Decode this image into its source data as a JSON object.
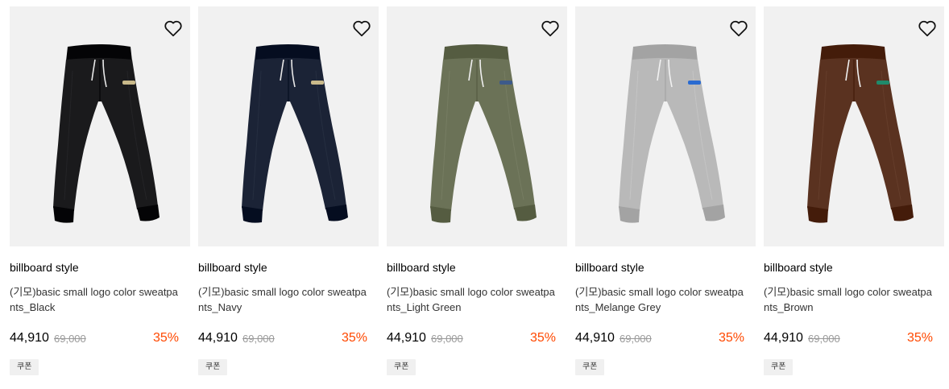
{
  "products": [
    {
      "brand": "billboard style",
      "name": "(기모)basic small logo color sweatpants_Black",
      "price": "44,910",
      "original_price": "69,000",
      "discount": "35%",
      "coupon": "쿠폰",
      "color": "#1a1a1c",
      "logo_color": "#c9b98a"
    },
    {
      "brand": "billboard style",
      "name": "(기모)basic small logo color sweatpants_Navy",
      "price": "44,910",
      "original_price": "69,000",
      "discount": "35%",
      "coupon": "쿠폰",
      "color": "#1b2336",
      "logo_color": "#c9b98a"
    },
    {
      "brand": "billboard style",
      "name": "(기모)basic small logo color sweatpants_Light Green",
      "price": "44,910",
      "original_price": "69,000",
      "discount": "35%",
      "coupon": "쿠폰",
      "color": "#6b7257",
      "logo_color": "#3d5a8a"
    },
    {
      "brand": "billboard style",
      "name": "(기모)basic small logo color sweatpants_Melange Grey",
      "price": "44,910",
      "original_price": "69,000",
      "discount": "35%",
      "coupon": "쿠폰",
      "color": "#b9b9b9",
      "logo_color": "#2a6bd1"
    },
    {
      "brand": "billboard style",
      "name": "(기모)basic small logo color sweatpants_Brown",
      "price": "44,910",
      "original_price": "69,000",
      "discount": "35%",
      "coupon": "쿠폰",
      "color": "#5a3220",
      "logo_color": "#1f8a6a"
    }
  ],
  "icons": {
    "wishlist": "heart-outline-icon"
  },
  "colors": {
    "discount": "#ff4800",
    "image_bg": "#f1f1f1",
    "coupon_bg": "#f0f0f0"
  }
}
